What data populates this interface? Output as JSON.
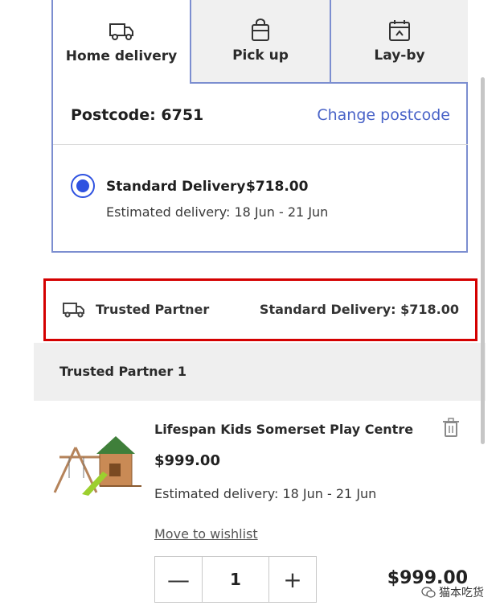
{
  "tabs": {
    "home": "Home delivery",
    "pickup": "Pick up",
    "layby": "Lay-by"
  },
  "postcode": {
    "label": "Postcode: 6751",
    "change_link": "Change postcode"
  },
  "delivery_option": {
    "title": "Standard Delivery",
    "price": "$718.00",
    "estimate": "Estimated delivery: 18 Jun - 21 Jun",
    "selected": true
  },
  "partner_summary": {
    "label": "Trusted Partner",
    "delivery": "Standard Delivery: $718.00"
  },
  "partner_group": {
    "title": "Trusted Partner 1"
  },
  "product": {
    "name": "Lifespan Kids Somerset Play Centre",
    "price": "$999.00",
    "estimate": "Estimated delivery: 18 Jun - 21 Jun",
    "wishlist_link": "Move to wishlist",
    "quantity": "1",
    "minus": "—",
    "plus": "+",
    "total": "$999.00"
  },
  "watermark": "猫本吃货",
  "colors": {
    "accent_blue": "#2f52e0",
    "link_blue": "#4a64c8",
    "highlight_red": "#d40000",
    "card_border": "#7c8ed0"
  }
}
